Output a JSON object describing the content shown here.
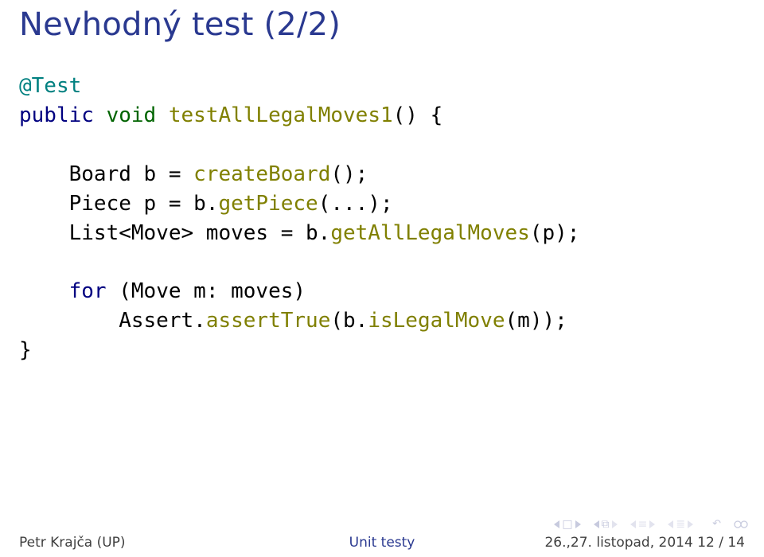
{
  "title": "Nevhodný test (2/2)",
  "code": {
    "l1a": "@Test",
    "l2a": "public ",
    "l2b": "void ",
    "l2c": "testAllLegalMoves1",
    "l2d": "() {",
    "l3": "",
    "l4a": "    Board b = ",
    "l4b": "createBoard",
    "l4c": "();",
    "l5a": "    Piece p = b.",
    "l5b": "getPiece",
    "l5c": "(...);",
    "l6a": "    List<Move> moves = b.",
    "l6b": "getAllLegalMoves",
    "l6c": "(p);",
    "l7": "",
    "l8a": "    ",
    "l8b": "for ",
    "l8c": "(Move m: moves)",
    "l9a": "        Assert.",
    "l9b": "assertTrue",
    "l9c": "(b.",
    "l9d": "isLegalMove",
    "l9e": "(m));",
    "l10": "}"
  },
  "footer": {
    "author": "Petr Krajča (UP)",
    "center": "Unit testy",
    "right": "26.,27. listopad, 2014    12 / 14"
  }
}
